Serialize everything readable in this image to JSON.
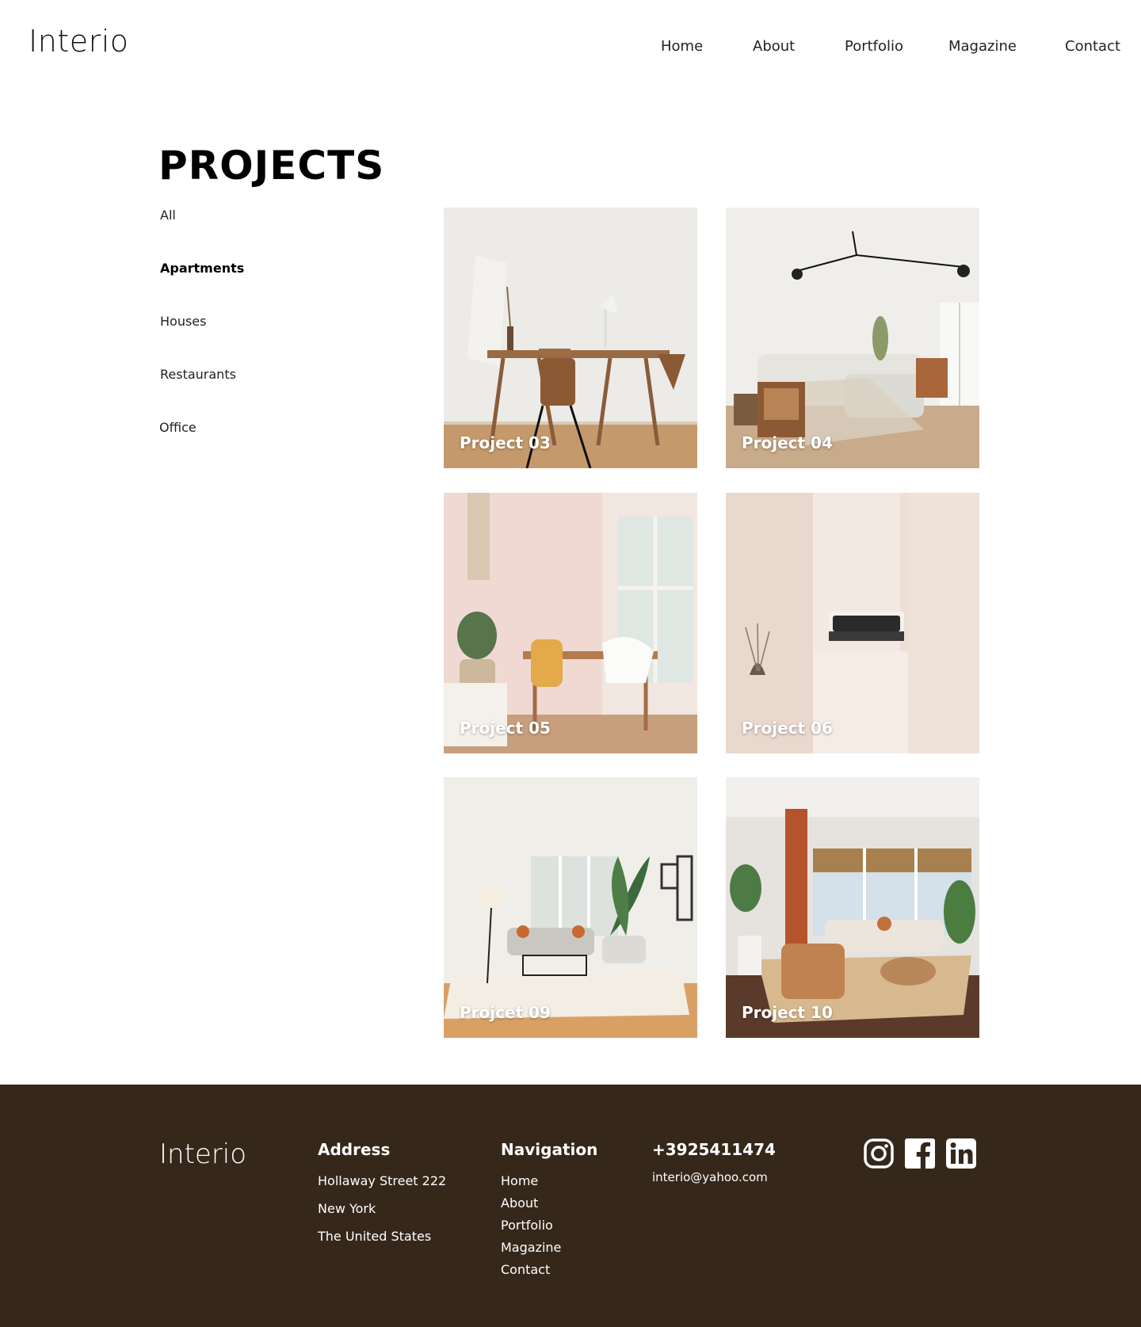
{
  "brand": {
    "logo": "Interio"
  },
  "nav": {
    "items": [
      {
        "label": "Home"
      },
      {
        "label": "About"
      },
      {
        "label": "Portfolio"
      },
      {
        "label": "Magazine"
      },
      {
        "label": "Contact"
      }
    ]
  },
  "projects": {
    "title": "PROJECTS",
    "filters": [
      {
        "label": "All",
        "active": false
      },
      {
        "label": "Apartments",
        "active": true
      },
      {
        "label": "Houses",
        "active": false
      },
      {
        "label": "Restaurants",
        "active": false
      },
      {
        "label": "Office",
        "active": false
      }
    ],
    "cards": [
      {
        "caption": "Project 03"
      },
      {
        "caption": "Project 04"
      },
      {
        "caption": "Project 05"
      },
      {
        "caption": "Project 06"
      },
      {
        "caption": "Projcet 09"
      },
      {
        "caption": "Project 10"
      }
    ]
  },
  "footer": {
    "logo": "Interio",
    "address": {
      "heading": "Address",
      "lines": [
        "Hollaway Street 222",
        "New York",
        "The United States"
      ]
    },
    "navigation": {
      "heading": "Navigation",
      "items": [
        "Home",
        "About",
        "Portfolio",
        "Magazine",
        "Contact"
      ]
    },
    "contact": {
      "phone": "+3925411474",
      "email": "interio@yahoo.com"
    },
    "socials": [
      {
        "icon": "instagram-icon"
      },
      {
        "icon": "facebook-icon"
      },
      {
        "icon": "linkedin-icon"
      }
    ]
  },
  "colors": {
    "footer_bg": "#35281b",
    "text": "#111111",
    "white": "#ffffff"
  }
}
